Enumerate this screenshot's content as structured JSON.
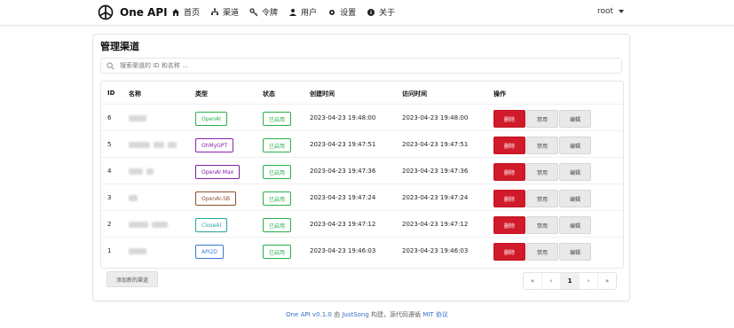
{
  "nav": {
    "brand": "One API",
    "items": [
      {
        "label": "首页",
        "icon": "home-icon"
      },
      {
        "label": "渠道",
        "icon": "sitemap-icon"
      },
      {
        "label": "令牌",
        "icon": "key-icon"
      },
      {
        "label": "用户",
        "icon": "user-icon"
      },
      {
        "label": "设置",
        "icon": "gear-icon"
      },
      {
        "label": "关于",
        "icon": "info-icon"
      }
    ],
    "user": "root"
  },
  "card": {
    "title": "管理渠道",
    "search_placeholder": "搜索渠道的 ID 和名称 ..."
  },
  "table": {
    "headers": [
      "ID",
      "名称",
      "类型",
      "状态",
      "创建时间",
      "访问时间",
      "操作"
    ],
    "rows": [
      {
        "id": "6",
        "type": "OpenAI",
        "type_color": "#2bb04a",
        "status": "已启用",
        "status_color": "#2bb04a",
        "created": "2023-04-23 19:48:00",
        "accessed": "2023-04-23 19:48:00"
      },
      {
        "id": "5",
        "type": "OhMyGPT",
        "type_color": "#8e24aa",
        "status": "已启用",
        "status_color": "#2bb04a",
        "created": "2023-04-23 19:47:51",
        "accessed": "2023-04-23 19:47:51"
      },
      {
        "id": "4",
        "type": "OpenAI Max",
        "type_color": "#7b1fa2",
        "status": "已启用",
        "status_color": "#2bb04a",
        "created": "2023-04-23 19:47:36",
        "accessed": "2023-04-23 19:47:36"
      },
      {
        "id": "3",
        "type": "OpenAI-SB",
        "type_color": "#8d4e2c",
        "status": "已启用",
        "status_color": "#2bb04a",
        "created": "2023-04-23 19:47:24",
        "accessed": "2023-04-23 19:47:24"
      },
      {
        "id": "2",
        "type": "CloseAI",
        "type_color": "#26a69a",
        "status": "已启用",
        "status_color": "#2bb04a",
        "created": "2023-04-23 19:47:12",
        "accessed": "2023-04-23 19:47:12"
      },
      {
        "id": "1",
        "type": "API2D",
        "type_color": "#3a7bd5",
        "status": "已启用",
        "status_color": "#2bb04a",
        "created": "2023-04-23 19:46:03",
        "accessed": "2023-04-23 19:46:03"
      }
    ],
    "actions": {
      "delete": "删除",
      "disable": "禁用",
      "edit": "编辑"
    }
  },
  "add_button": "添加新的渠道",
  "pager": [
    "«",
    "‹",
    "1",
    "›",
    "»"
  ],
  "footer": {
    "app": "One API v0.1.0",
    "by": "由",
    "author": "JustSong",
    "built": "构建，源代码遵循",
    "license": "MIT 协议"
  }
}
